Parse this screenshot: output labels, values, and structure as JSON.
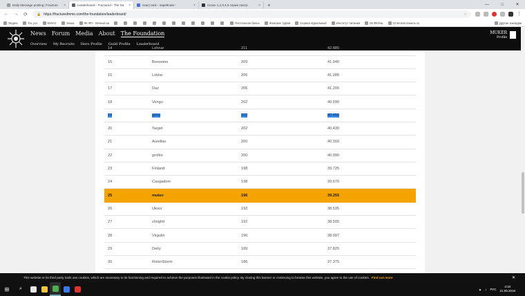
{
  "browser": {
    "tabs": [
      {
        "title": "Daily Message posting | Fracture",
        "favicon_color": "#999999",
        "active": false
      },
      {
        "title": "Leaderboard - Fractured - The Sa",
        "favicon_color": "#5f6368",
        "active": true
      },
      {
        "title": "exact rank - парейские -",
        "favicon_color": "#4a6fd6",
        "active": false
      },
      {
        "title": "Сезон 1,2,3,4,5 серии смотр",
        "favicon_color": "#333333",
        "active": false
      }
    ],
    "new_tab_label": "+",
    "window_controls": {
      "minimize": "—",
      "maximize": "□",
      "close": "✕"
    },
    "url": "https://fracturedmmo.com/the-foundation/leaderboard/",
    "bookmarks": [
      "Яндекс",
      "Тос усл",
      "EMIAC",
      "Элька",
      "ЛК ФП - Личный ка",
      "",
      "",
      "",
      "",
      "",
      "",
      "",
      "",
      "",
      "",
      "",
      "",
      "Постельное белье",
      "Женские туфли",
      "Сериал Идеальный",
      "Институт питания",
      "05 ФКУКЬ",
      "Отчетная панель ск"
    ],
    "bookmarks_other": "Другие закладки"
  },
  "site": {
    "main_nav": [
      {
        "label": "News",
        "selected": false
      },
      {
        "label": "Forum",
        "selected": false
      },
      {
        "label": "Media",
        "selected": false
      },
      {
        "label": "About",
        "selected": false
      },
      {
        "label": "The Foundation",
        "selected": true
      }
    ],
    "sub_nav": [
      "Overview",
      "My Recruits",
      "Hero Profile",
      "Guild Profile",
      "Leaderboard"
    ],
    "user": {
      "name": "MUKER",
      "sub": "Profile"
    }
  },
  "leaderboard": {
    "rows": [
      {
        "rank": "14",
        "name": "Lehnar",
        "level": "211",
        "score": "42.885",
        "state": "partial"
      },
      {
        "rank": "15",
        "name": "Benseine",
        "level": "209",
        "score": "41.940",
        "state": ""
      },
      {
        "rank": "16",
        "name": "Loktar",
        "level": "206",
        "score": "41.285",
        "state": ""
      },
      {
        "rank": "17",
        "name": "Daz",
        "level": "206",
        "score": "41.205",
        "state": ""
      },
      {
        "rank": "18",
        "name": "Vengu",
        "level": "202",
        "score": "40.590",
        "state": ""
      },
      {
        "rank": "19",
        "name": "gonp",
        "level": "202",
        "score": "40.450",
        "state": "selected"
      },
      {
        "rank": "20",
        "name": "Target",
        "level": "202",
        "score": "40.430",
        "state": ""
      },
      {
        "rank": "21",
        "name": "Aurellas",
        "level": "200",
        "score": "40.160",
        "state": ""
      },
      {
        "rank": "22",
        "name": "grofire",
        "level": "200",
        "score": "40.090",
        "state": ""
      },
      {
        "rank": "23",
        "name": "Finland",
        "level": "198",
        "score": "39.725",
        "state": ""
      },
      {
        "rank": "24",
        "name": "Casgadom",
        "level": "198",
        "score": "39.670",
        "state": ""
      },
      {
        "rank": "25",
        "name": "muker",
        "level": "196",
        "score": "39.255",
        "state": "highlight"
      },
      {
        "rank": "26",
        "name": "Ukurv",
        "level": "192",
        "score": "38.535",
        "state": ""
      },
      {
        "rank": "27",
        "name": "chrightt",
        "level": "192",
        "score": "38.505",
        "state": ""
      },
      {
        "rank": "28",
        "name": "Virgulin",
        "level": "190",
        "score": "38.097",
        "state": ""
      },
      {
        "rank": "29",
        "name": "Deity",
        "level": "189",
        "score": "37.825",
        "state": ""
      },
      {
        "rank": "30",
        "name": "RolanStorm",
        "level": "186",
        "score": "37.375",
        "state": ""
      }
    ]
  },
  "cookie_banner": {
    "text": "This website or its third party tools use cookies, which are necessary to its functioning and required to achieve the purposes illustrated in the cookie policy. By closing this banner or continuing to browse this website, you agree to the use of cookies.",
    "link": "Find out more",
    "close": "✕"
  },
  "taskbar": {
    "start_icon": "windows-logo",
    "search_icon": "search",
    "apps": [
      "#e8e8e8",
      "#f5c542",
      "#4caf50",
      "#3b78e7",
      "#d33"
    ],
    "lang": "РУС",
    "time": "3:34",
    "date": "21.09.2018"
  }
}
